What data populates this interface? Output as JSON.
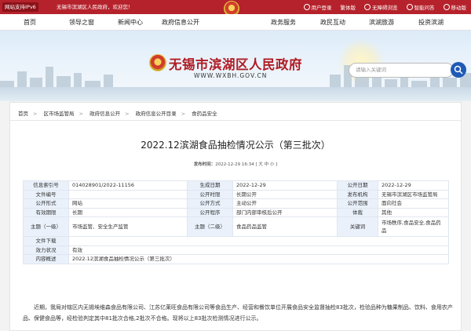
{
  "topbar": {
    "ipv6": "网站支持IPv6",
    "welcome": "无锡市滨湖区人民政府，欢迎您！",
    "links": [
      {
        "label": "用户登录",
        "icon": "user-icon"
      },
      {
        "label": "繁体版",
        "icon": null
      },
      {
        "label": "无障碍浏览",
        "icon": "accessibility-icon"
      },
      {
        "label": "智能问答",
        "icon": "chat-icon"
      },
      {
        "label": "移动版",
        "icon": "mobile-icon"
      }
    ]
  },
  "nav": [
    "首页",
    "领导之窗",
    "新闻中心",
    "政府信息公开",
    "政务服务",
    "政民互动",
    "滨湖旅游",
    "投资滨湖"
  ],
  "banner": {
    "title": "无锡市滨湖区人民政府",
    "url": "WWW.WXBH.GOV.CN",
    "search_placeholder": "请输入关键词"
  },
  "breadcrumb": [
    "首页",
    "区市场监管局",
    "政府信息公开",
    "政府信息公开目录",
    "食药品安全"
  ],
  "article": {
    "title": "2022.12滨湖食品抽检情况公示（第三批次）",
    "meta_label": "发布时间：",
    "meta_time": "2022-12-29 16:34",
    "meta_font": "[ 大 中 小 ]",
    "body": "近期，我局对辖区内无锡埃维森食品有限公司、江苏亿莱旺食品有限公司等食品生产、经营和餐饮单位开展食品安全监督抽检83批次，检验品种为糖果制品、饮料、食用农产品、保健食品等，经检验判定其中81批次合格,2批次不合格。现将以上83批次检测情况进行公示。"
  },
  "info_table": {
    "r1": [
      "信息索引号",
      "014028901/2022-11156",
      "生成日期",
      "2022-12-29",
      "公开日期",
      "2022-12-29"
    ],
    "r2": [
      "文件编号",
      "",
      "公开时限",
      "长期公开",
      "发布机构",
      "无锡市滨湖区市场监管局"
    ],
    "r3": [
      "公开形式",
      "网站",
      "公开方式",
      "主动公开",
      "公开范围",
      "面向社会"
    ],
    "r4": [
      "有效期限",
      "长期",
      "公开程序",
      "部门内部审核后公开",
      "体裁",
      "其他"
    ],
    "r5": [
      "主题（一级）",
      "市场监管、安全生产监管",
      "主题（二级）",
      "食品药品监管",
      "关键词",
      "市场秩序,食品安全,食品药品"
    ],
    "r6": [
      "文件下载",
      ""
    ],
    "r7": [
      "效力状况",
      "有效"
    ],
    "r8": [
      "内容概述",
      "2022.12滨湖食品抽检情况公示（第三批次）"
    ]
  }
}
